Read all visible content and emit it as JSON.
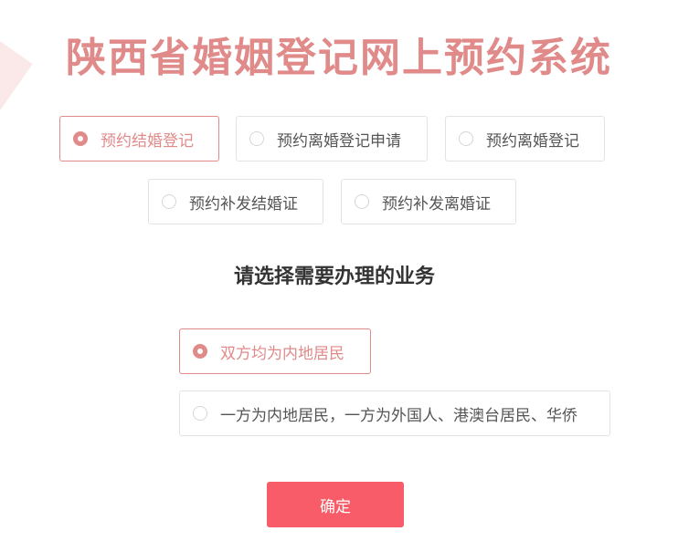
{
  "page": {
    "title": "陕西省婚姻登记网上预约系统"
  },
  "type_options": [
    {
      "label": "预约结婚登记",
      "selected": true
    },
    {
      "label": "预约离婚登记申请",
      "selected": false
    },
    {
      "label": "预约离婚登记",
      "selected": false
    },
    {
      "label": "预约补发结婚证",
      "selected": false
    },
    {
      "label": "预约补发离婚证",
      "selected": false
    }
  ],
  "business": {
    "heading": "请选择需要办理的业务",
    "options": [
      {
        "label": "双方均为内地居民",
        "selected": true
      },
      {
        "label": "一方为内地居民，一方为外国人、港澳台居民、华侨",
        "selected": false
      }
    ]
  },
  "actions": {
    "confirm_label": "确定"
  },
  "colors": {
    "accent": "#e08a8a",
    "button": "#f75c68",
    "border": "#e3e3e3"
  }
}
